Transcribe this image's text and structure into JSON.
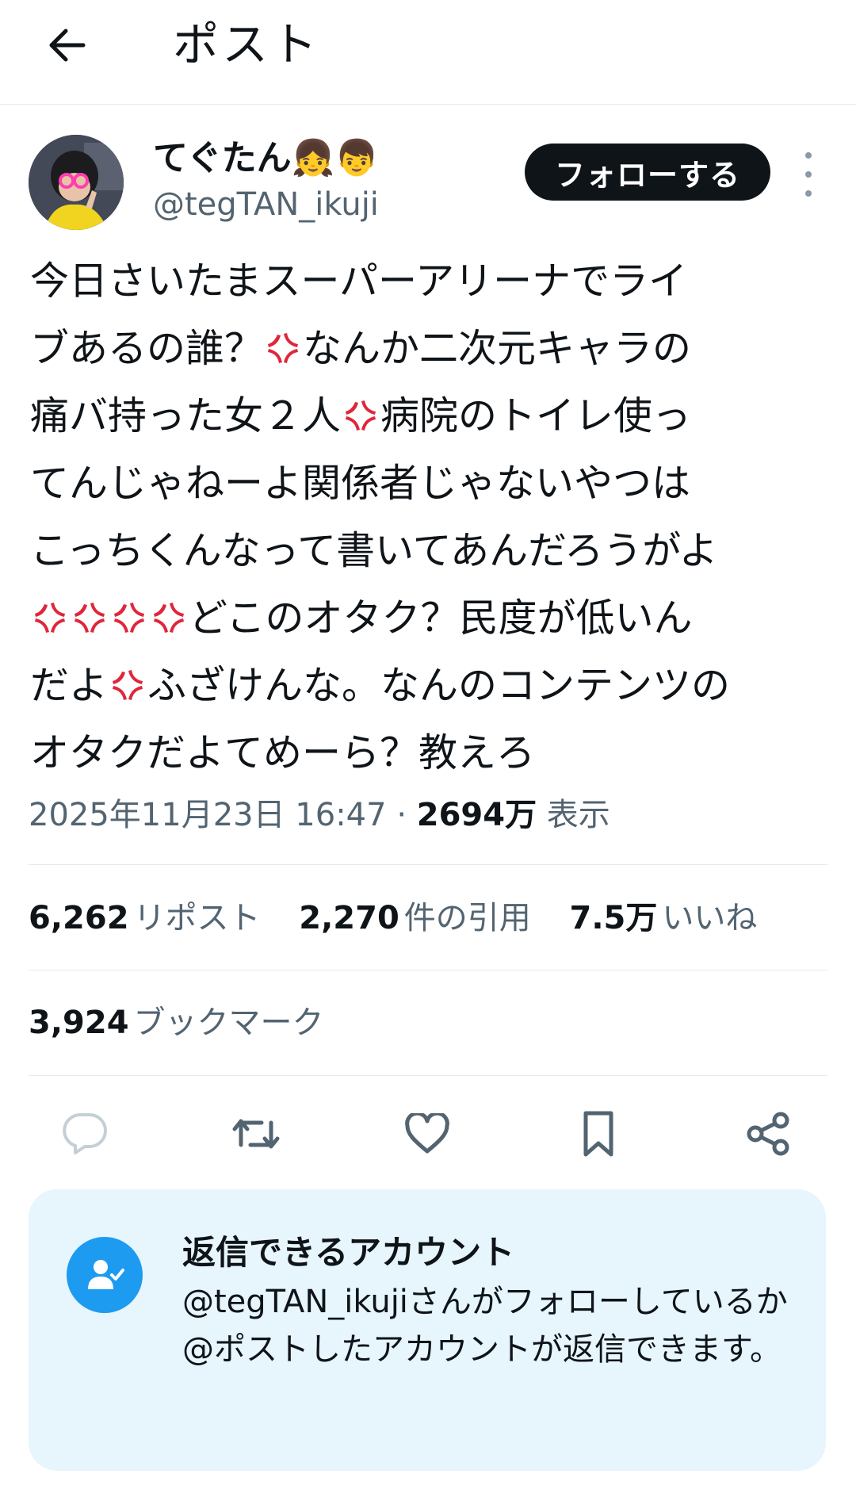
{
  "header": {
    "title": "ポスト",
    "back_icon": "arrow-left-icon"
  },
  "author": {
    "display_name": "てぐたん👧👦",
    "handle": "@tegTAN_ikuji",
    "follow_label": "フォローする"
  },
  "post": {
    "lines": [
      "今日さいたまスーパーアリーナでライ",
      "ブあるの誰？[anger]なんか二次元キャラの",
      "痛バ持った女２人[anger]病院のトイレ使っ",
      "てんじゃねーよ関係者じゃないやつは",
      "こっちくんなって書いてあんだろうがよ",
      "[anger][anger][anger][anger]どこのオタク？民度が低いん",
      "だよ[anger]ふざけんな。なんのコンテンツの",
      "オタクだよてめーら？教えろ"
    ],
    "emoji_name": "anger-symbol-emoji"
  },
  "meta": {
    "timestamp": "2025年11月23日 16:47",
    "separator": "·",
    "views_count": "2694万",
    "views_label": "表示"
  },
  "stats": {
    "reposts": {
      "num": "6,262",
      "label": "リポスト"
    },
    "quotes": {
      "num": "2,270",
      "label": "件の引用"
    },
    "likes": {
      "num": "7.5万",
      "label": "いいね"
    },
    "bookmarks": {
      "num": "3,924",
      "label": "ブックマーク"
    }
  },
  "actions": [
    "reply-icon",
    "repost-icon",
    "like-icon",
    "bookmark-icon",
    "share-icon"
  ],
  "reply_settings": {
    "title": "返信できるアカウント",
    "description": "@tegTAN_ikujiさんがフォローしているか@ポストしたアカウントが返信できます。"
  },
  "colors": {
    "text": "#0f1419",
    "secondary": "#536471",
    "accent": "#1d9bf0",
    "anger": "#e0263a",
    "reply_box_bg": "#e7f5fd"
  }
}
